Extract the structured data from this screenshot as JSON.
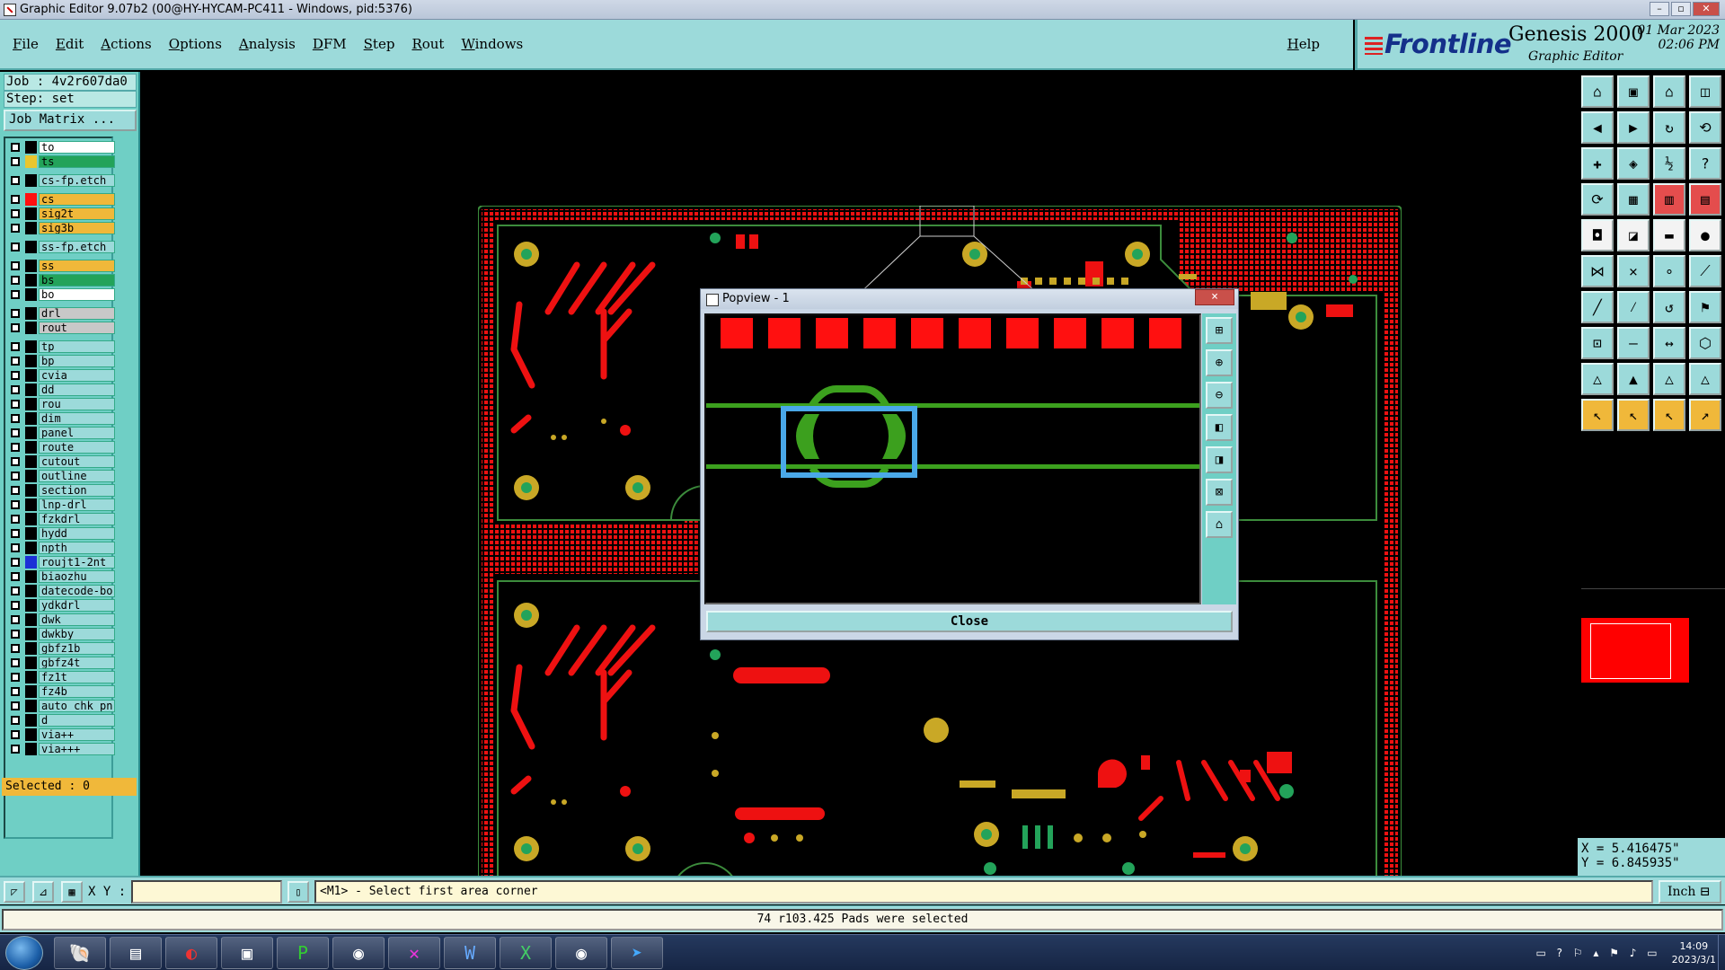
{
  "window": {
    "title": "Graphic Editor 9.07b2 (00@HY-HYCAM-PC411 - Windows, pid:5376)"
  },
  "menu": {
    "items": [
      "File",
      "Edit",
      "Actions",
      "Options",
      "Analysis",
      "DFM",
      "Step",
      "Rout",
      "Windows"
    ],
    "help": "Help"
  },
  "brand": {
    "logo": "Frontline",
    "product": "Genesis 2000",
    "subtitle": "Graphic Editor",
    "date": "01 Mar 2023",
    "time": "02:06 PM"
  },
  "job": {
    "job_line": "Job : 4v2r607da0",
    "step_line": "Step: set",
    "matrix_button": "Job Matrix ..."
  },
  "layers": [
    {
      "name": "to",
      "color": "#000000",
      "bg": "white",
      "gap": false
    },
    {
      "name": "ts",
      "color": "#e9c62e",
      "bg": "green",
      "gap": true
    },
    {
      "name": "cs-fp.etch",
      "color": "#000000",
      "bg": "cyan",
      "gap": true
    },
    {
      "name": "cs",
      "color": "#ff1010",
      "bg": "orange",
      "gap": false
    },
    {
      "name": "sig2t",
      "color": "#000000",
      "bg": "orange",
      "gap": false
    },
    {
      "name": "sig3b",
      "color": "#000000",
      "bg": "orange",
      "gap": true
    },
    {
      "name": "ss-fp.etch",
      "color": "#000000",
      "bg": "cyan",
      "gap": true
    },
    {
      "name": "ss",
      "color": "#000000",
      "bg": "orange",
      "gap": false
    },
    {
      "name": "bs",
      "color": "#000000",
      "bg": "green",
      "gap": false
    },
    {
      "name": "bo",
      "color": "#000000",
      "bg": "white",
      "gap": true
    },
    {
      "name": "drl",
      "color": "#000000",
      "bg": "gray",
      "gap": false
    },
    {
      "name": "rout",
      "color": "#000000",
      "bg": "gray",
      "gap": true
    },
    {
      "name": "tp",
      "color": "#000000",
      "bg": "cyan",
      "gap": false
    },
    {
      "name": "bp",
      "color": "#000000",
      "bg": "cyan",
      "gap": false
    },
    {
      "name": "cvia",
      "color": "#000000",
      "bg": "cyan",
      "gap": false
    },
    {
      "name": "dd",
      "color": "#000000",
      "bg": "cyan",
      "gap": false
    },
    {
      "name": "rou",
      "color": "#000000",
      "bg": "cyan",
      "gap": false
    },
    {
      "name": "dim",
      "color": "#000000",
      "bg": "cyan",
      "gap": false
    },
    {
      "name": "panel",
      "color": "#000000",
      "bg": "cyan",
      "gap": false
    },
    {
      "name": "route",
      "color": "#000000",
      "bg": "cyan",
      "gap": false
    },
    {
      "name": "cutout",
      "color": "#000000",
      "bg": "cyan",
      "gap": false
    },
    {
      "name": "outline",
      "color": "#000000",
      "bg": "cyan",
      "gap": false
    },
    {
      "name": "section",
      "color": "#000000",
      "bg": "cyan",
      "gap": false
    },
    {
      "name": "lnp-drl",
      "color": "#000000",
      "bg": "cyan",
      "gap": false
    },
    {
      "name": "fzkdrl",
      "color": "#000000",
      "bg": "cyan",
      "gap": false
    },
    {
      "name": "hydd",
      "color": "#000000",
      "bg": "cyan",
      "gap": false
    },
    {
      "name": "npth",
      "color": "#000000",
      "bg": "cyan",
      "gap": false
    },
    {
      "name": "roujt1-2nt",
      "color": "#1b2fd6",
      "bg": "cyan",
      "gap": false
    },
    {
      "name": "biaozhu",
      "color": "#000000",
      "bg": "cyan",
      "gap": false
    },
    {
      "name": "datecode-bo",
      "color": "#000000",
      "bg": "cyan",
      "gap": false
    },
    {
      "name": "ydkdrl",
      "color": "#000000",
      "bg": "cyan",
      "gap": false
    },
    {
      "name": "dwk",
      "color": "#000000",
      "bg": "cyan",
      "gap": false
    },
    {
      "name": "dwkby",
      "color": "#000000",
      "bg": "cyan",
      "gap": false
    },
    {
      "name": "gbfz1b",
      "color": "#000000",
      "bg": "cyan",
      "gap": false
    },
    {
      "name": "gbfz4t",
      "color": "#000000",
      "bg": "cyan",
      "gap": false
    },
    {
      "name": "fz1t",
      "color": "#000000",
      "bg": "cyan",
      "gap": false
    },
    {
      "name": "fz4b",
      "color": "#000000",
      "bg": "cyan",
      "gap": false
    },
    {
      "name": "auto_chk_pn",
      "color": "#000000",
      "bg": "cyan",
      "gap": false
    },
    {
      "name": "d",
      "color": "#000000",
      "bg": "cyan",
      "gap": false
    },
    {
      "name": "via++",
      "color": "#000000",
      "bg": "cyan",
      "gap": false
    },
    {
      "name": "via+++",
      "color": "#000000",
      "bg": "cyan",
      "gap": false
    }
  ],
  "selected_count": "Selected : 0",
  "popview": {
    "title": "Popview - 1",
    "close_label": "Close",
    "close_icon": "×"
  },
  "coordinates": {
    "x": "X = 5.416475\"",
    "y": "Y = 6.845935\""
  },
  "command": {
    "xy_label": "X Y :",
    "xy_value": "",
    "prompt": "<M1> - Select first area corner",
    "unit": "Inch"
  },
  "status": {
    "message": "74 r103.425 Pads were selected"
  },
  "taskbar": {
    "time": "14:09",
    "date": "2023/3/1"
  },
  "colors": {
    "panel": "#9cdada",
    "copper": "#ff1010",
    "pad": "#c9a826",
    "via": "#23a35a",
    "outline": "#3c8c3c"
  }
}
